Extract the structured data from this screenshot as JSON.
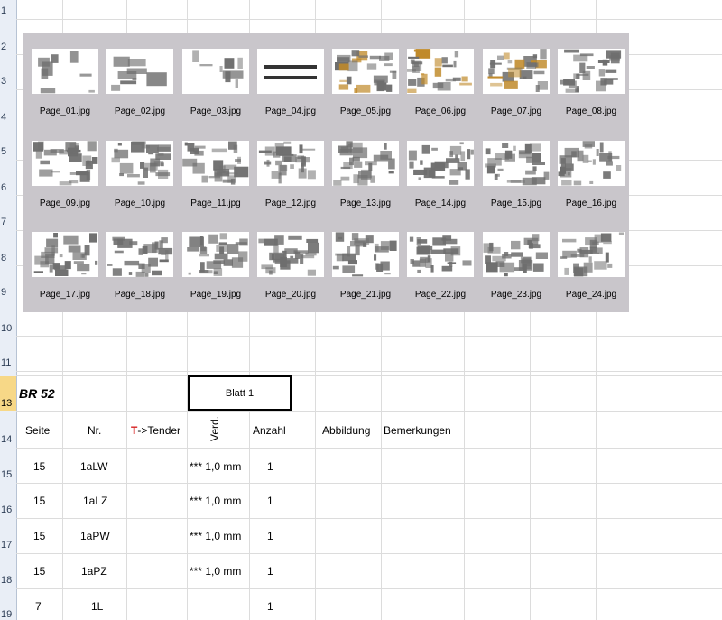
{
  "rows": [
    "1",
    "2",
    "3",
    "4",
    "5",
    "6",
    "7",
    "8",
    "9",
    "10",
    "11",
    "13",
    "14",
    "15",
    "16",
    "17",
    "18",
    "19"
  ],
  "active_row": "13",
  "thumbnails": [
    "Page_01.jpg",
    "Page_02.jpg",
    "Page_03.jpg",
    "Page_04.jpg",
    "Page_05.jpg",
    "Page_06.jpg",
    "Page_07.jpg",
    "Page_08.jpg",
    "Page_09.jpg",
    "Page_10.jpg",
    "Page_11.jpg",
    "Page_12.jpg",
    "Page_13.jpg",
    "Page_14.jpg",
    "Page_15.jpg",
    "Page_16.jpg",
    "Page_17.jpg",
    "Page_18.jpg",
    "Page_19.jpg",
    "Page_20.jpg",
    "Page_21.jpg",
    "Page_22.jpg",
    "Page_23.jpg",
    "Page_24.jpg"
  ],
  "sheet": {
    "title": "BR 52",
    "blatt": "Blatt 1",
    "headers": {
      "seite": "Seite",
      "nr": "Nr.",
      "tender_prefix": "T",
      "tender_rest": "->Tender",
      "verd": "Verd.",
      "anzahl": "Anzahl",
      "abbildung": "Abbildung",
      "bemerkungen": "Bemerkungen"
    },
    "rows": [
      {
        "seite": "15",
        "nr": "1aLW",
        "verd": "*** 1,0 mm",
        "anzahl": "1"
      },
      {
        "seite": "15",
        "nr": "1aLZ",
        "verd": "*** 1,0 mm",
        "anzahl": "1"
      },
      {
        "seite": "15",
        "nr": "1aPW",
        "verd": "*** 1,0 mm",
        "anzahl": "1"
      },
      {
        "seite": "15",
        "nr": "1aPZ",
        "verd": "*** 1,0 mm",
        "anzahl": "1"
      },
      {
        "seite": "7",
        "nr": "1L",
        "verd": "",
        "anzahl": "1"
      }
    ]
  },
  "colors": {
    "panel": "#c9c6cb",
    "part_gray": "#6e6e6e",
    "part_orange": "#c08a2a",
    "tender_red": "#d62020",
    "active_row": "#f7d887"
  }
}
